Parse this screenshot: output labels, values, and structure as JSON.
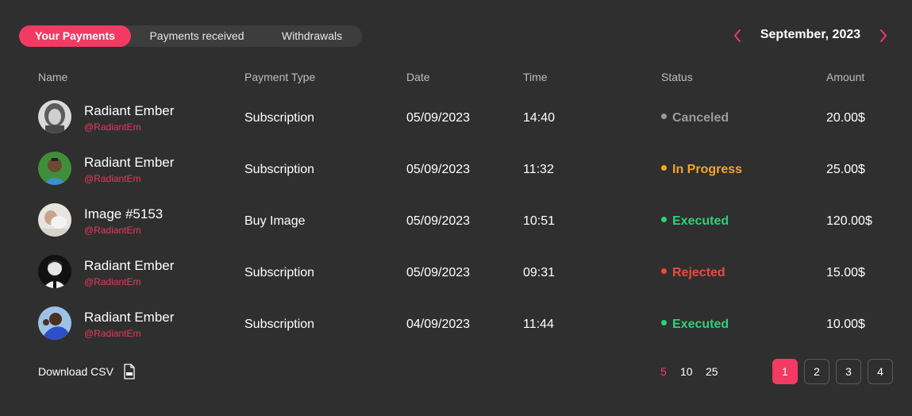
{
  "tabs": [
    {
      "label": "Your Payments",
      "active": true
    },
    {
      "label": "Payments received",
      "active": false
    },
    {
      "label": "Withdrawals",
      "active": false
    }
  ],
  "month_nav": {
    "label": "September, 2023",
    "prev_icon": "chevron-left-icon",
    "next_icon": "chevron-right-icon"
  },
  "columns": {
    "name": "Name",
    "payment_type": "Payment Type",
    "date": "Date",
    "time": "Time",
    "status": "Status",
    "amount": "Amount"
  },
  "colors": {
    "accent": "#f23a63",
    "canceled": "#9a9aa0",
    "in_progress": "#f5a524",
    "executed": "#2fd07a",
    "rejected": "#ef4a3c"
  },
  "rows": [
    {
      "name": "Radiant Ember",
      "handle": "@RadiantEm",
      "payment_type": "Subscription",
      "date": "05/09/2023",
      "time": "14:40",
      "status": "Canceled",
      "status_color": "#9a9aa0",
      "amount": "20.00$"
    },
    {
      "name": "Radiant Ember",
      "handle": "@RadiantEm",
      "payment_type": "Subscription",
      "date": "05/09/2023",
      "time": "11:32",
      "status": "In Progress",
      "status_color": "#f5a524",
      "amount": "25.00$"
    },
    {
      "name": "Image #5153",
      "handle": "@RadiantEm",
      "payment_type": "Buy Image",
      "date": "05/09/2023",
      "time": "10:51",
      "status": "Executed",
      "status_color": "#2fd07a",
      "amount": "120.00$"
    },
    {
      "name": "Radiant Ember",
      "handle": "@RadiantEm",
      "payment_type": "Subscription",
      "date": "05/09/2023",
      "time": "09:31",
      "status": "Rejected",
      "status_color": "#ef4a3c",
      "amount": "15.00$"
    },
    {
      "name": "Radiant Ember",
      "handle": "@RadiantEm",
      "payment_type": "Subscription",
      "date": "04/09/2023",
      "time": "11:44",
      "status": "Executed",
      "status_color": "#2fd07a",
      "amount": "10.00$"
    }
  ],
  "footer": {
    "download_label": "Download CSV",
    "download_icon": "csv-file-icon",
    "per_page_options": [
      "5",
      "10",
      "25"
    ],
    "per_page_selected": "5",
    "pages": [
      "1",
      "2",
      "3",
      "4"
    ],
    "current_page": "1"
  }
}
